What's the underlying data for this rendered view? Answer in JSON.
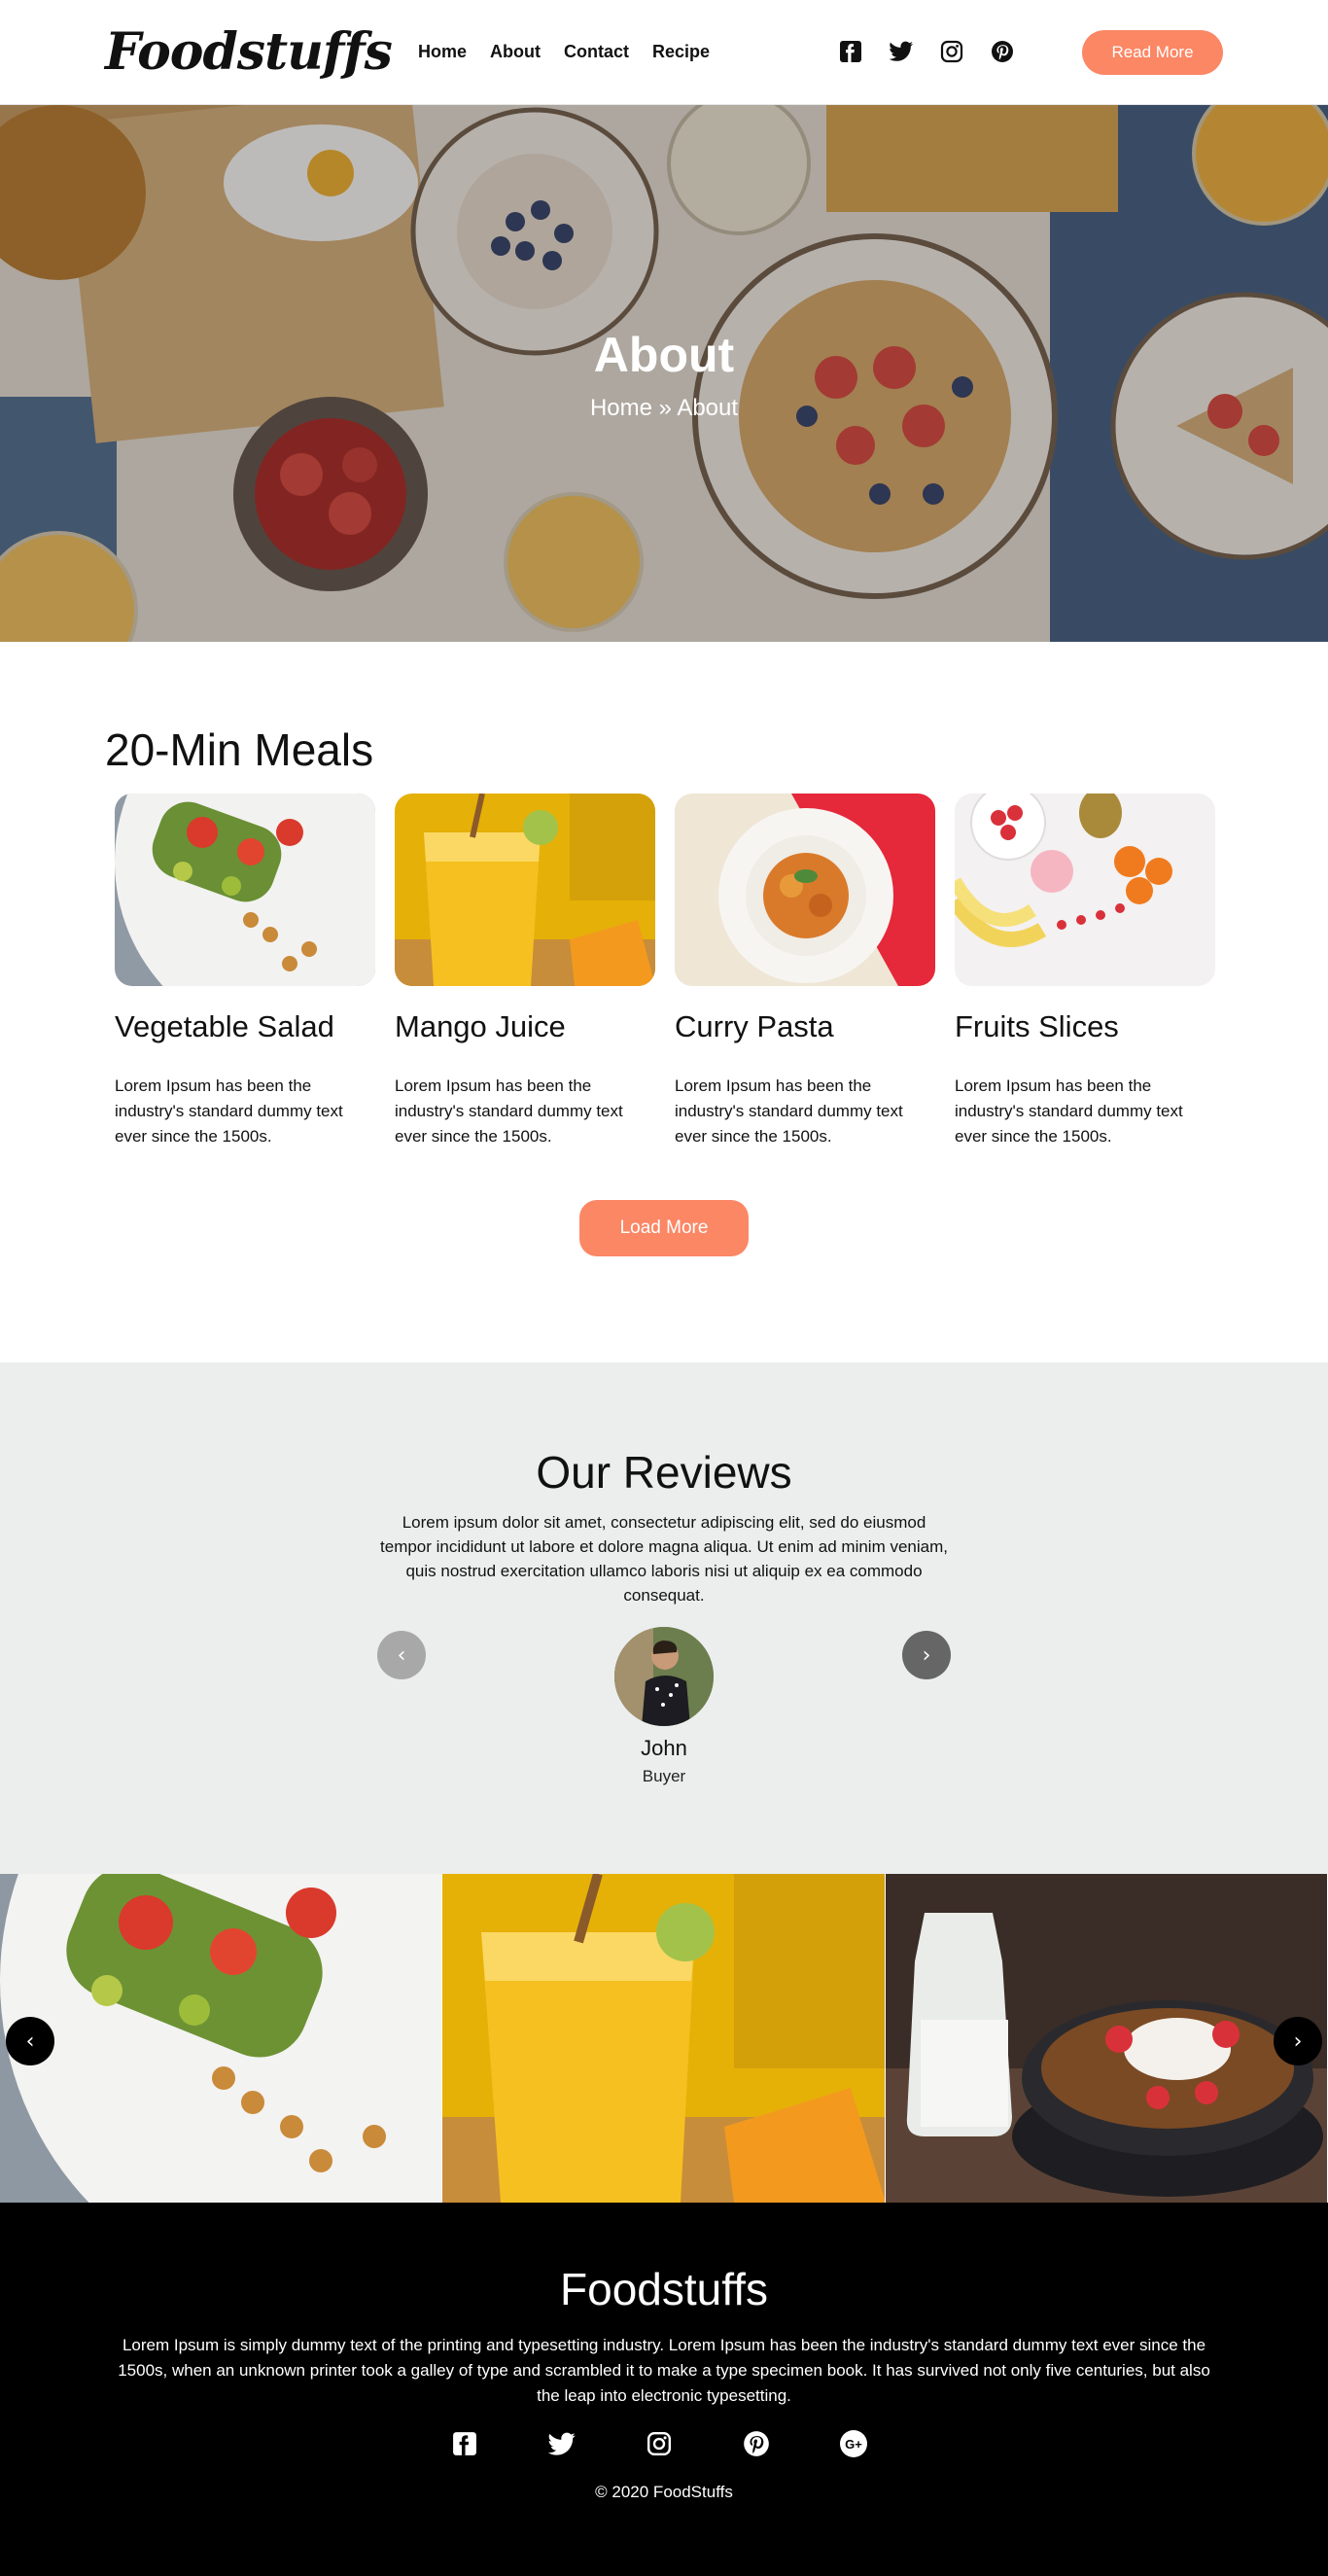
{
  "header": {
    "logo": "Foodstuffs",
    "nav": [
      "Home",
      "About",
      "Contact",
      "Recipe"
    ],
    "social_icons": [
      "facebook-square-icon",
      "twitter-icon",
      "instagram-icon",
      "pinterest-icon"
    ],
    "cta_label": "Read More"
  },
  "hero": {
    "title": "About",
    "breadcrumb": "Home » About"
  },
  "meals": {
    "title": "20-Min Meals",
    "cards": [
      {
        "title": "Vegetable Salad",
        "text": "Lorem Ipsum has been the industry's standard dummy text ever since the 1500s."
      },
      {
        "title": "Mango Juice",
        "text": "Lorem Ipsum has been the industry's standard dummy text ever since the 1500s."
      },
      {
        "title": "Curry Pasta",
        "text": "Lorem Ipsum has been the industry's standard dummy text ever since the 1500s."
      },
      {
        "title": "Fruits Slices",
        "text": "Lorem Ipsum has been the industry's standard dummy text ever since the 1500s."
      }
    ],
    "load_more_label": "Load More"
  },
  "reviews": {
    "title": "Our Reviews",
    "text": "Lorem ipsum dolor sit amet, consectetur adipiscing elit, sed do eiusmod tempor incididunt ut labore et dolore magna aliqua. Ut enim ad minim veniam, quis nostrud exercitation ullamco laboris nisi ut aliquip ex ea commodo consequat.",
    "prev_arrow": "‹",
    "next_arrow": "›",
    "reviewer_name": "John",
    "reviewer_role": "Buyer"
  },
  "gallery": {
    "prev_arrow": "‹",
    "next_arrow": "›"
  },
  "footer": {
    "title": "Foodstuffs",
    "text": "Lorem Ipsum is simply dummy text of the printing and typesetting industry. Lorem Ipsum has been the industry's standard dummy text ever since the 1500s, when an unknown printer took a galley of type and scrambled it to make a type specimen book. It has survived not only five centuries, but also the leap into electronic typesetting.",
    "social_icons": [
      "facebook-square-icon",
      "twitter-icon",
      "instagram-icon",
      "pinterest-icon",
      "google-plus-icon"
    ],
    "copyright": "© 2020 FoodStuffs"
  },
  "colors": {
    "accent": "#fb8765",
    "reviews_bg": "#eceeed",
    "footer_bg": "#000000"
  }
}
